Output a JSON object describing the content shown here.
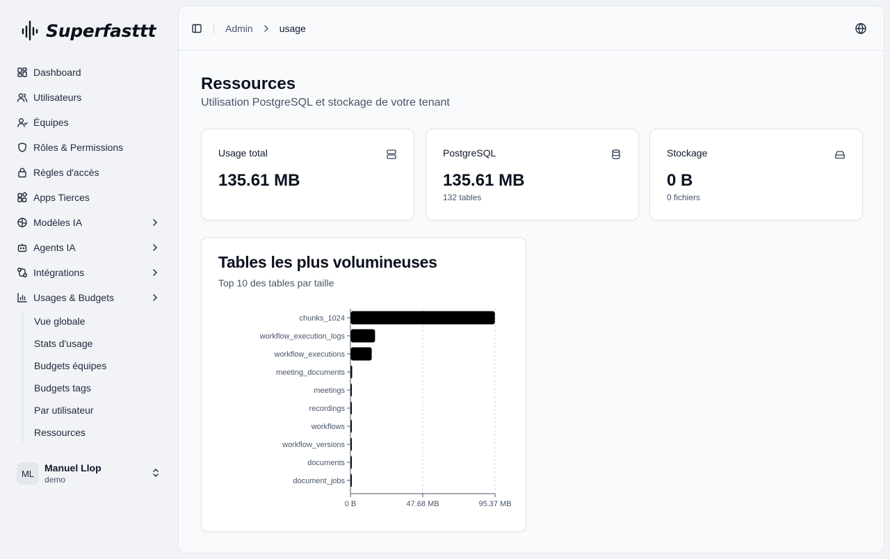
{
  "app": {
    "name": "Superfasttt"
  },
  "sidebar": {
    "items": [
      {
        "label": "Dashboard",
        "icon": "dashboard-icon"
      },
      {
        "label": "Utilisateurs",
        "icon": "users-icon"
      },
      {
        "label": "Équipes",
        "icon": "team-icon"
      },
      {
        "label": "Rôles & Permissions",
        "icon": "shield-icon"
      },
      {
        "label": "Règles d'accès",
        "icon": "lock-icon"
      },
      {
        "label": "Apps Tierces",
        "icon": "apps-icon"
      },
      {
        "label": "Modèles IA",
        "icon": "brain-icon"
      },
      {
        "label": "Agents IA",
        "icon": "bot-icon"
      },
      {
        "label": "Intégrations",
        "icon": "integration-icon"
      },
      {
        "label": "Usages & Budgets",
        "icon": "bar-chart-icon"
      }
    ],
    "subitems": [
      "Vue globale",
      "Stats d'usage",
      "Budgets équipes",
      "Budgets tags",
      "Par utilisateur",
      "Ressources"
    ]
  },
  "user": {
    "initials": "ML",
    "name": "Manuel Llop",
    "tenant": "demo"
  },
  "breadcrumb": {
    "parent": "Admin",
    "current": "usage"
  },
  "page": {
    "title": "Ressources",
    "subtitle": "Utilisation PostgreSQL et stockage de votre tenant"
  },
  "stats": [
    {
      "label": "Usage total",
      "value": "135.61 MB",
      "sub": "",
      "icon": "server-icon"
    },
    {
      "label": "PostgreSQL",
      "value": "135.61 MB",
      "sub": "132 tables",
      "icon": "database-icon"
    },
    {
      "label": "Stockage",
      "value": "0 B",
      "sub": "0 fichiers",
      "icon": "hard-drive-icon"
    }
  ],
  "chart": {
    "title": "Tables les plus volumineuses",
    "subtitle": "Top 10 des tables par taille"
  },
  "chart_data": {
    "type": "bar",
    "orientation": "horizontal",
    "categories": [
      "chunks_1024",
      "workflow_execution_logs",
      "workflow_executions",
      "meeting_documents",
      "meetings",
      "recordings",
      "workflows",
      "workflow_versions",
      "documents",
      "document_jobs"
    ],
    "values": [
      95.0,
      16.0,
      13.8,
      0.9,
      0.7,
      0.5,
      0.3,
      0.3,
      0.2,
      0.2
    ],
    "unit": "MB",
    "x_ticks": [
      "0 B",
      "47.68 MB",
      "95.37 MB"
    ],
    "xlim": [
      0,
      95.37
    ],
    "color": "#000000",
    "grid": "vertical dashed"
  }
}
